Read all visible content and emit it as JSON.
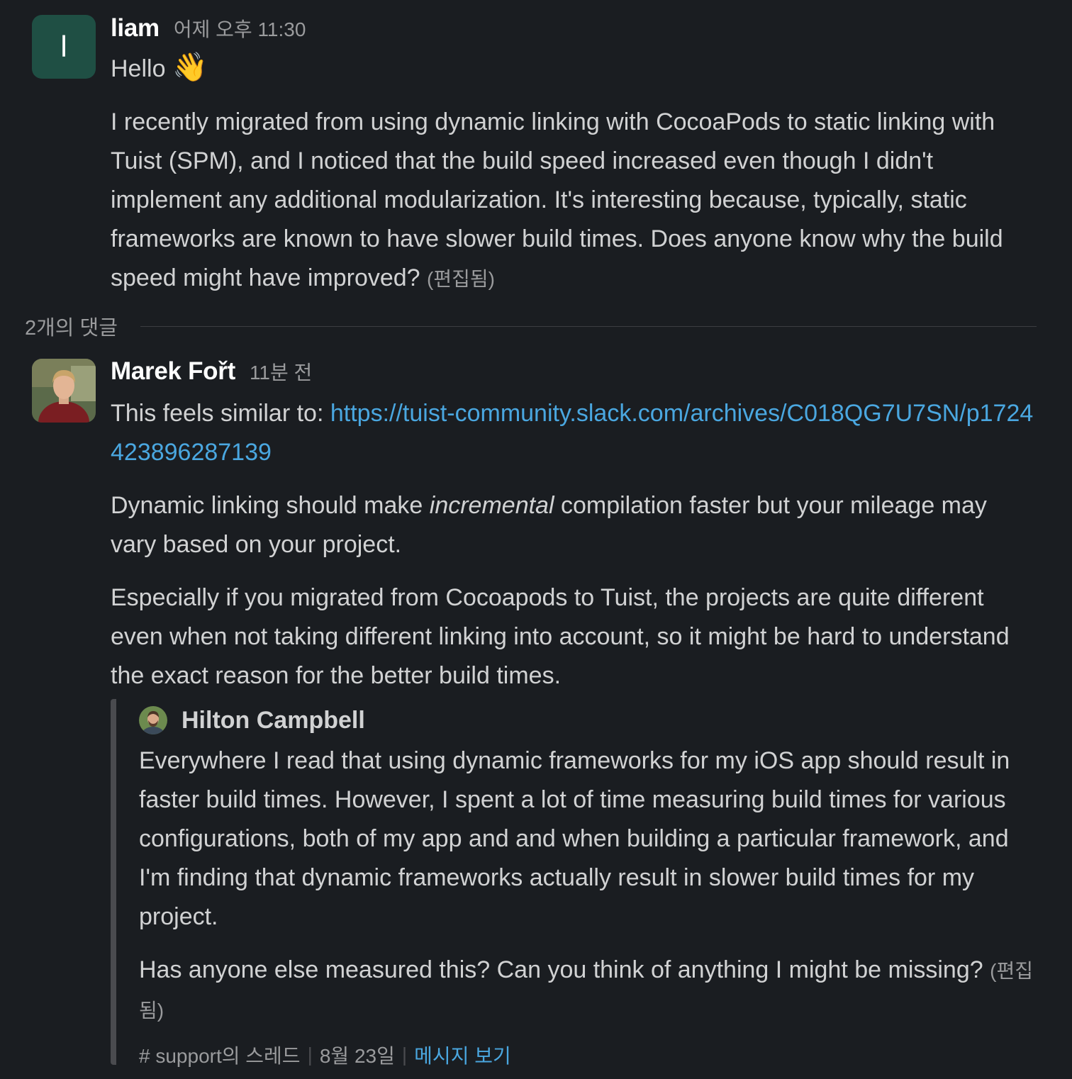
{
  "messages": {
    "first": {
      "avatar_letter": "l",
      "author": "liam",
      "timestamp": "어제 오후 11:30",
      "greeting": "Hello",
      "greeting_emoji": "👋",
      "body": "I recently migrated from using dynamic linking with CocoaPods to static linking with Tuist (SPM), and I noticed that the build speed increased even though I didn't implement any additional modularization. It's interesting because, typically, static frameworks are known to have slower build times. Does anyone know why the build speed might have improved?",
      "edited": "(편집됨)"
    },
    "replies_label": "2개의 댓글",
    "reply": {
      "author": "Marek Fořt",
      "timestamp": "11분 전",
      "p1_prefix": "This feels similar to: ",
      "p1_link": "https://tuist-community.slack.com/archives/C018QG7U7SN/p1724423896287139",
      "p2_a": "Dynamic linking should make ",
      "p2_em": "incremental",
      "p2_b": " compilation faster but your mileage may vary based on your project.",
      "p3": "Especially if you migrated from Cocoapods to Tuist, the projects are quite different even when not taking different linking into account, so it might be hard to understand the exact reason for the better build times."
    },
    "quote": {
      "author": "Hilton Campbell",
      "p1": "Everywhere I read that using dynamic frameworks for my iOS app should result in faster build times. However, I spent a lot of time measuring build times for various configurations, both of my app and and when building a particular framework, and I'm finding that dynamic frameworks actually result in slower build times for my project.",
      "p2": "Has anyone else measured this? Can you think of anything I might be missing?",
      "edited": "(편집됨)",
      "channel": "# support의 스레드",
      "date": "8월 23일",
      "view_message": "메시지 보기"
    }
  },
  "colors": {
    "background": "#1a1d21",
    "text": "#d1d2d3",
    "muted": "#9a9b9d",
    "link": "#4aa7e0",
    "avatar_bg": "#1f4f44"
  }
}
